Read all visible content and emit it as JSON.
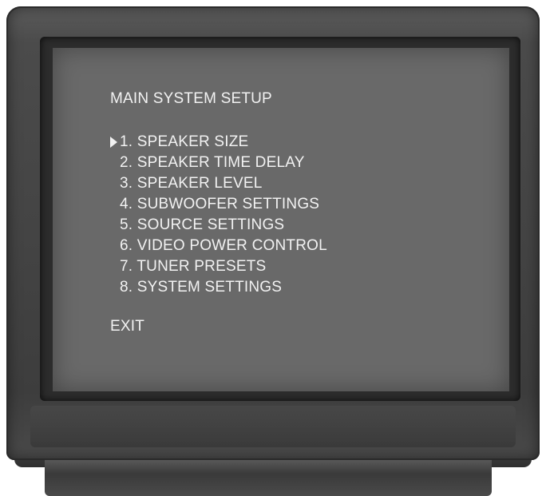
{
  "screen": {
    "title": "MAIN SYSTEM SETUP",
    "selected_index": 0,
    "cursor_icon": "triangle-right-icon",
    "items": [
      {
        "label": "1. SPEAKER SIZE"
      },
      {
        "label": "2. SPEAKER TIME DELAY"
      },
      {
        "label": "3. SPEAKER LEVEL"
      },
      {
        "label": "4. SUBWOOFER SETTINGS"
      },
      {
        "label": "5. SOURCE SETTINGS"
      },
      {
        "label": "6. VIDEO POWER CONTROL"
      },
      {
        "label": "7. TUNER PRESETS"
      },
      {
        "label": "8. SYSTEM SETTINGS"
      }
    ],
    "exit_label": "EXIT"
  },
  "colors": {
    "screen_bg": "#696969",
    "text": "#f2f2f2",
    "bezel": "#444444"
  }
}
